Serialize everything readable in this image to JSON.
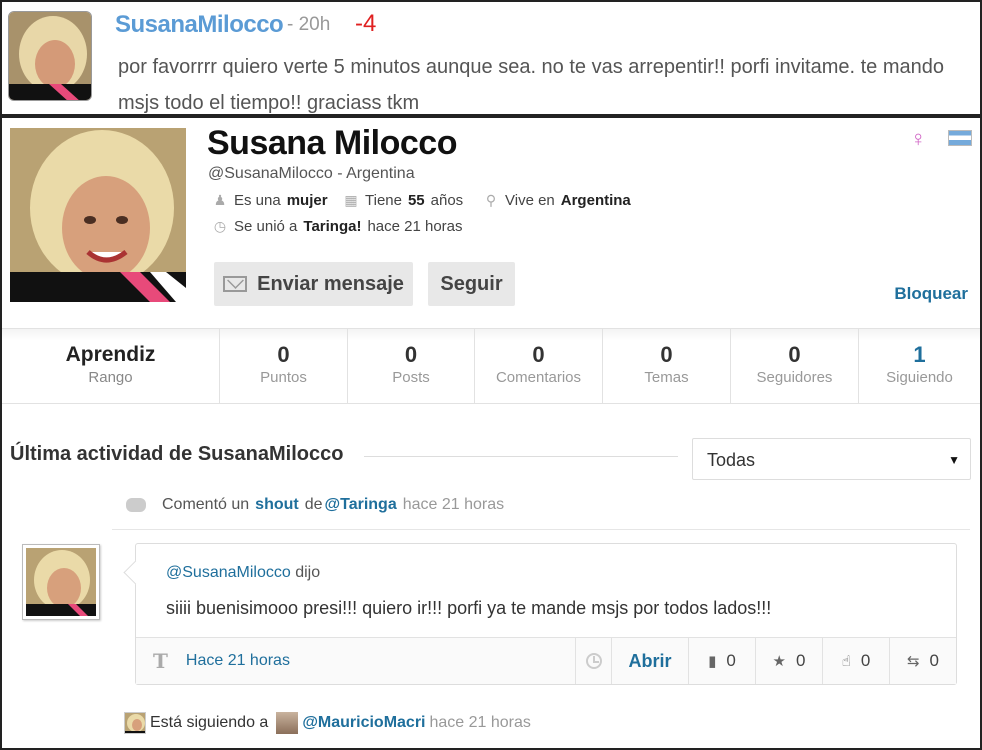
{
  "top_comment": {
    "username": "SusanaMilocco",
    "time": "- 20h",
    "score": "-4",
    "text": "por favorrrr quiero verte 5 minutos aunque sea. no te vas arrepentir!! porfi invitame. te mando msjs todo el tiempo!! graciass tkm"
  },
  "profile": {
    "name": "Susana Milocco",
    "handle": "@SusanaMilocco",
    "country_suffix": "- Argentina",
    "gender_prefix": "Es una",
    "gender": "mujer",
    "age_prefix": "Tiene",
    "age": "55",
    "age_suffix": "años",
    "location_prefix": "Vive en",
    "location": "Argentina",
    "joined_prefix": "Se unió a",
    "joined_site": "Taringa!",
    "joined_time": "hace 21 horas",
    "send_message_label": "Enviar mensaje",
    "follow_label": "Seguir",
    "block_label": "Bloquear",
    "gender_icon": "female-symbol-icon",
    "flag_icon": "argentina-flag-icon"
  },
  "stats": [
    {
      "value": "Aprendiz",
      "label": "Rango"
    },
    {
      "value": "0",
      "label": "Puntos"
    },
    {
      "value": "0",
      "label": "Posts"
    },
    {
      "value": "0",
      "label": "Comentarios"
    },
    {
      "value": "0",
      "label": "Temas"
    },
    {
      "value": "0",
      "label": "Seguidores"
    },
    {
      "value": "1",
      "label": "Siguiendo"
    }
  ],
  "activity": {
    "title": "Última actividad de SusanaMilocco",
    "filter_value": "Todas",
    "comment_event": {
      "verb": "Comentó un",
      "object": "shout",
      "prep": "de",
      "target": "@Taringa",
      "time": "hace 21 horas"
    },
    "shout": {
      "author": "@SusanaMilocco",
      "said": "dijo",
      "text": "siiii buenisimooo presi!!! quiero ir!!! porfi ya te mande msjs por todos lados!!!",
      "time": "Hace 21 horas",
      "open_label": "Abrir",
      "comments": "0",
      "favorites": "0",
      "likes": "0",
      "reshares": "0"
    },
    "follow_event": {
      "verb": "Está siguiendo a",
      "target": "@MauricioMacri",
      "time": "hace 21 horas"
    }
  },
  "colors": {
    "link": "#1f6f9c",
    "username_blue": "#5b9bd5",
    "score_red": "#e02020"
  }
}
